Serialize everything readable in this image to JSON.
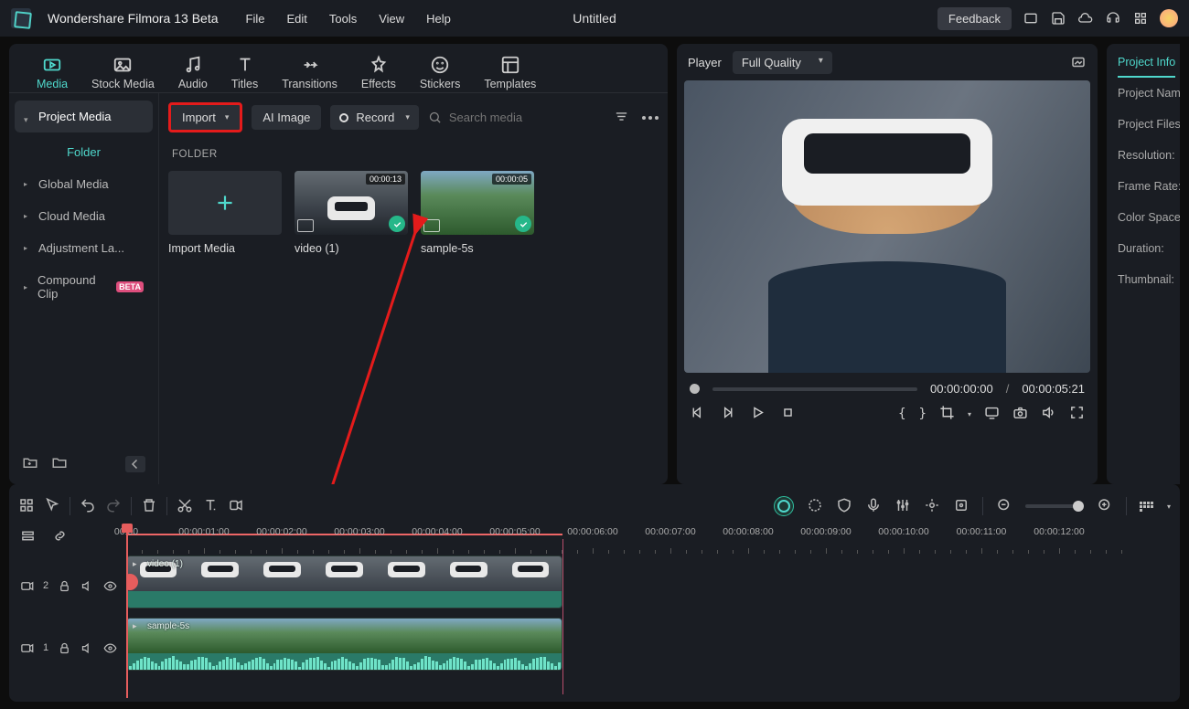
{
  "app": {
    "title": "Wondershare Filmora 13 Beta",
    "doc_title": "Untitled",
    "feedback": "Feedback",
    "menus": [
      "File",
      "Edit",
      "Tools",
      "View",
      "Help"
    ]
  },
  "tabs": [
    {
      "label": "Media",
      "active": true
    },
    {
      "label": "Stock Media"
    },
    {
      "label": "Audio"
    },
    {
      "label": "Titles"
    },
    {
      "label": "Transitions"
    },
    {
      "label": "Effects"
    },
    {
      "label": "Stickers"
    },
    {
      "label": "Templates"
    }
  ],
  "sidebar": {
    "header": "Project Media",
    "folder_label": "Folder",
    "items": [
      {
        "label": "Global Media"
      },
      {
        "label": "Cloud Media"
      },
      {
        "label": "Adjustment La..."
      },
      {
        "label": "Compound Clip",
        "beta": "BETA"
      }
    ]
  },
  "toolbar": {
    "import": "Import",
    "ai_image": "AI Image",
    "record": "Record",
    "search_placeholder": "Search media"
  },
  "media": {
    "folder_lbl": "FOLDER",
    "import_media": "Import Media",
    "clips": [
      {
        "name": "video (1)",
        "duration": "00:00:13"
      },
      {
        "name": "sample-5s",
        "duration": "00:00:05"
      }
    ]
  },
  "preview": {
    "player_label": "Player",
    "quality": "Full Quality",
    "time_current": "00:00:00:00",
    "time_total": "00:00:05:21",
    "sep": "/"
  },
  "props": {
    "tab": "Project Info",
    "rows": [
      "Project Name",
      "Project Files l",
      "Resolution:",
      "Frame Rate:",
      "Color Space:",
      "Duration:",
      "Thumbnail:"
    ]
  },
  "ruler": {
    "labels": [
      "00:00",
      "00:00:01:00",
      "00:00:02:00",
      "00:00:03:00",
      "00:00:04:00",
      "00:00:05:00",
      "00:00:06:00",
      "00:00:07:00",
      "00:00:08:00",
      "00:00:09:00",
      "00:00:10:00",
      "00:00:11:00",
      "00:00:12:00"
    ]
  },
  "tracks": {
    "t1_num": "1",
    "t2_num": "2",
    "clip1": "video (1)",
    "clip2": "sample-5s"
  }
}
